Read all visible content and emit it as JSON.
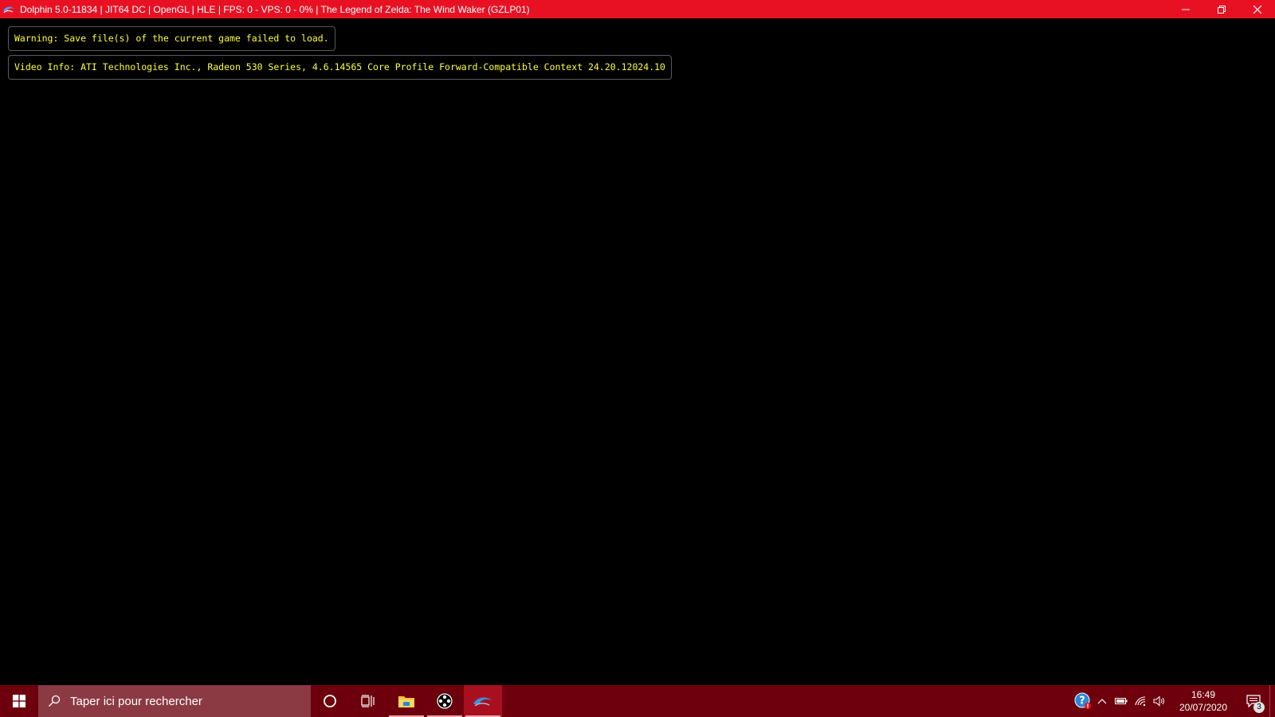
{
  "window": {
    "title": "Dolphin 5.0-11834 | JIT64 DC | OpenGL | HLE | FPS: 0 - VPS: 0 - 0% | The Legend of Zelda: The Wind Waker (GZLP01)",
    "app_icon": "dolphin-icon",
    "controls": [
      "minimize-icon",
      "restore-icon",
      "close-icon"
    ],
    "accent_color": "#e81123"
  },
  "osd": {
    "warning": "Warning: Save file(s) of the current game failed to load.",
    "video_info": "Video Info: ATI Technologies Inc., Radeon 530 Series, 4.6.14565 Core Profile Forward-Compatible Context 24.20.12024.10",
    "text_color": "#ffff33"
  },
  "taskbar": {
    "background": "#6d000c",
    "search_placeholder": "Taper ici pour rechercher",
    "pinned": [
      {
        "name": "cortana",
        "icon": "cortana-circle-icon"
      },
      {
        "name": "task-view",
        "icon": "task-view-icon"
      },
      {
        "name": "file-explorer",
        "icon": "folder-icon"
      },
      {
        "name": "controller-app",
        "icon": "gamepad-icon"
      },
      {
        "name": "dolphin",
        "icon": "dolphin-icon"
      }
    ],
    "tray": {
      "time": "16:49",
      "date": "20/07/2020",
      "notification_count": "3"
    }
  }
}
